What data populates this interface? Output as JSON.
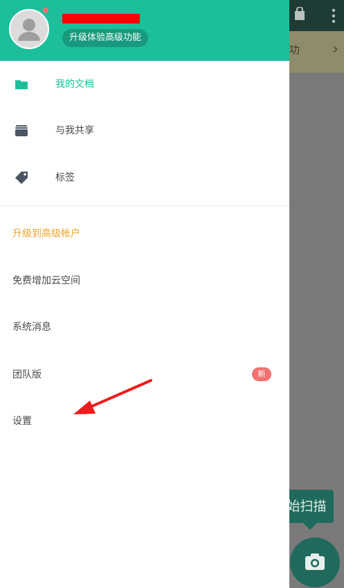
{
  "background": {
    "banner_text": "功",
    "banner_chevron": "›",
    "scan_tooltip": "始扫描"
  },
  "drawer": {
    "upgrade_button": "升级体验高级功能",
    "primary_items": [
      {
        "label": "我的文档",
        "icon": "folder-icon",
        "active": true
      },
      {
        "label": "与我共享",
        "icon": "stack-icon",
        "active": false
      },
      {
        "label": "标签",
        "icon": "tag-icon",
        "active": false
      }
    ],
    "secondary_items": [
      {
        "label": "升级到高级帐户"
      },
      {
        "label": "免费增加云空间"
      },
      {
        "label": "系统消息"
      },
      {
        "label": "团队版",
        "badge": "新"
      },
      {
        "label": "设置"
      }
    ]
  },
  "colors": {
    "accent": "#1dbf9a",
    "upgrade_text": "#f0a32a",
    "badge": "#f27171",
    "annotation_arrow": "#ee1c1c"
  }
}
